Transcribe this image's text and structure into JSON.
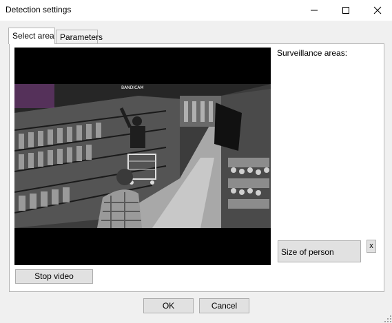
{
  "window": {
    "title": "Detection settings",
    "controls": {
      "minimize": "minimize-icon",
      "maximize": "maximize-icon",
      "close": "close-icon"
    }
  },
  "tabs": [
    {
      "label": "Select area",
      "active": true
    },
    {
      "label": "Parameters",
      "active": false
    }
  ],
  "panel": {
    "surveillance_label": "Surveillance areas:",
    "person_size_label": "Size of person",
    "remove_label": "x",
    "stop_video_label": "Stop video",
    "video_watermark": "BANDICAM"
  },
  "footer": {
    "ok_label": "OK",
    "cancel_label": "Cancel"
  },
  "colors": {
    "client_bg": "#f0f0f0",
    "button_bg": "#e1e1e1",
    "button_border": "#adadad",
    "video_bg": "#000000"
  }
}
